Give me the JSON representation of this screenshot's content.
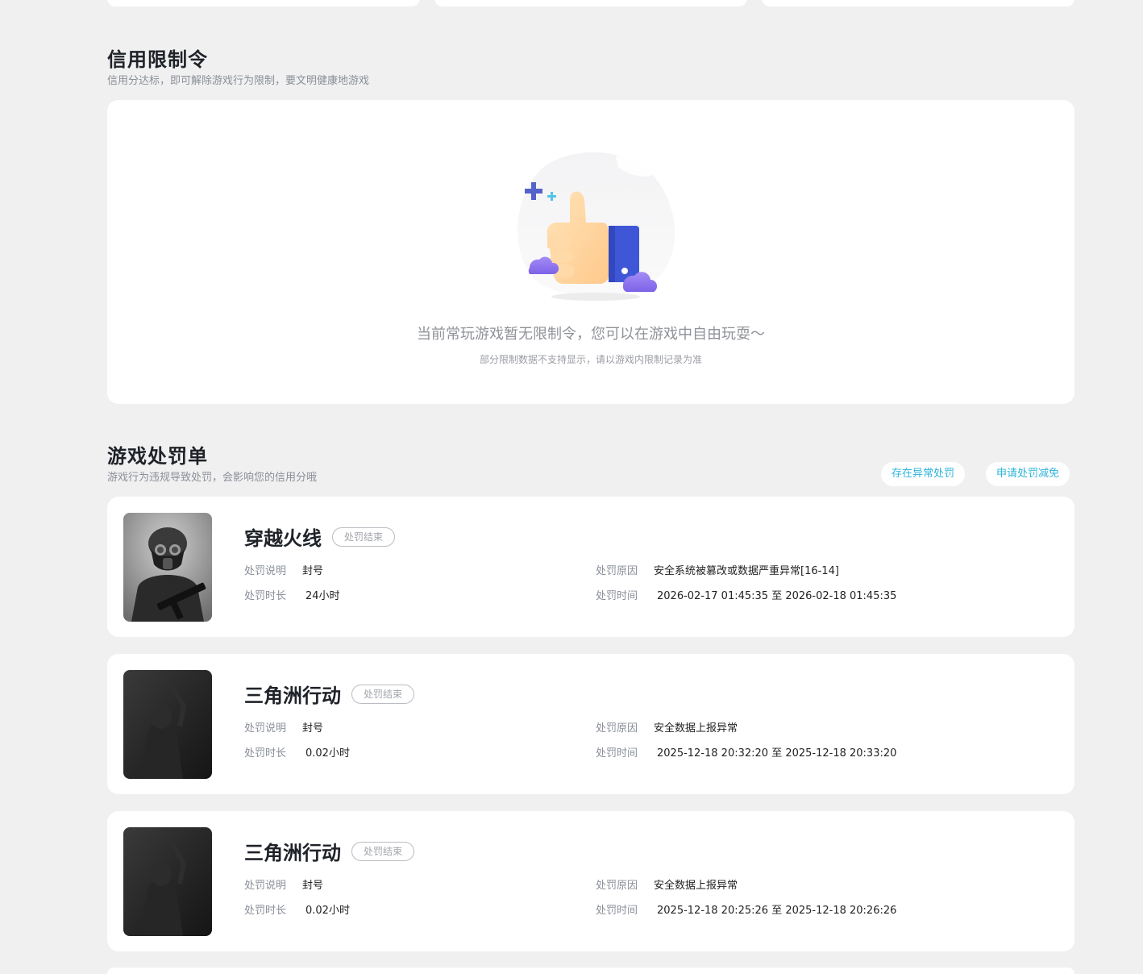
{
  "credit_section": {
    "title": "信用限制令",
    "subtitle": "信用分达标，即可解除游戏行为限制，要文明健康地游戏",
    "empty_message": "当前常玩游戏暂无限制令，您可以在游戏中自由玩耍～",
    "empty_note": "部分限制数据不支持显示，请以游戏内限制记录为准",
    "illustration_icon": "thumbs-up-illustration"
  },
  "penalty_section": {
    "title": "游戏处罚单",
    "subtitle": "游戏行为违规导致处罚，会影响您的信用分哦",
    "btn_abnormal": "存在异常处罚",
    "btn_reduce": "申请处罚减免",
    "accent_color": "#2db4d9",
    "labels": {
      "desc": "处罚说明",
      "duration": "处罚时长",
      "reason": "处罚原因",
      "time": "处罚时间"
    },
    "items": [
      {
        "game": "穿越火线",
        "status": "处罚结束",
        "desc": "封号",
        "duration": "24小时",
        "reason": "安全系统被篡改或数据严重异常[16-14]",
        "time": "2026-02-17 01:45:35 至 2026-02-18 01:45:35"
      },
      {
        "game": "三角洲行动",
        "status": "处罚结束",
        "desc": "封号",
        "duration": "0.02小时",
        "reason": "安全数据上报异常",
        "time": "2025-12-18 20:32:20 至 2025-12-18 20:33:20"
      },
      {
        "game": "三角洲行动",
        "status": "处罚结束",
        "desc": "封号",
        "duration": "0.02小时",
        "reason": "安全数据上报异常",
        "time": "2025-12-18 20:25:26 至 2025-12-18 20:26:26"
      }
    ]
  }
}
